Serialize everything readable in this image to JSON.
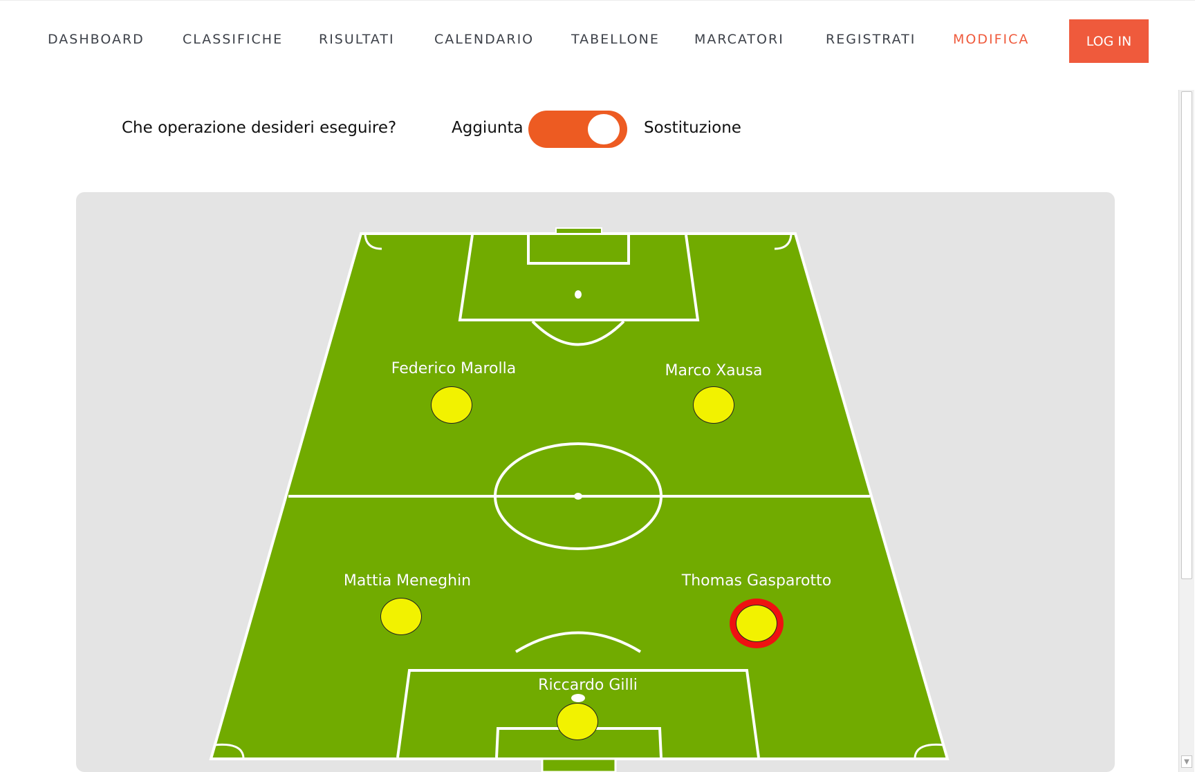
{
  "nav": {
    "items": [
      {
        "label": "DASHBOARD",
        "active": false
      },
      {
        "label": "CLASSIFICHE",
        "active": false
      },
      {
        "label": "RISULTATI",
        "active": false
      },
      {
        "label": "CALENDARIO",
        "active": false
      },
      {
        "label": "TABELLONE",
        "active": false
      },
      {
        "label": "MARCATORI",
        "active": false
      },
      {
        "label": "REGISTRATI",
        "active": false
      },
      {
        "label": "MODIFICA",
        "active": true
      }
    ],
    "login_label": "LOG IN"
  },
  "operation": {
    "question": "Che operazione desideri eseguire?",
    "option_left": "Aggiunta",
    "option_right": "Sostituzione",
    "toggle_state": "Sostituzione"
  },
  "lineup": {
    "players": [
      {
        "name": "Federico Marolla",
        "selected": false
      },
      {
        "name": "Marco Xausa",
        "selected": false
      },
      {
        "name": "Mattia Meneghin",
        "selected": false
      },
      {
        "name": "Thomas Gasparotto",
        "selected": true
      },
      {
        "name": "Riccardo Gilli",
        "selected": false
      }
    ]
  },
  "colors": {
    "accent": "#ef5a3c",
    "toggle": "#ed5b22",
    "pitch": "#71ab00",
    "player": "#f2f200",
    "selected_ring": "#ee1111"
  },
  "icons": {
    "scroll_down": "▼"
  }
}
